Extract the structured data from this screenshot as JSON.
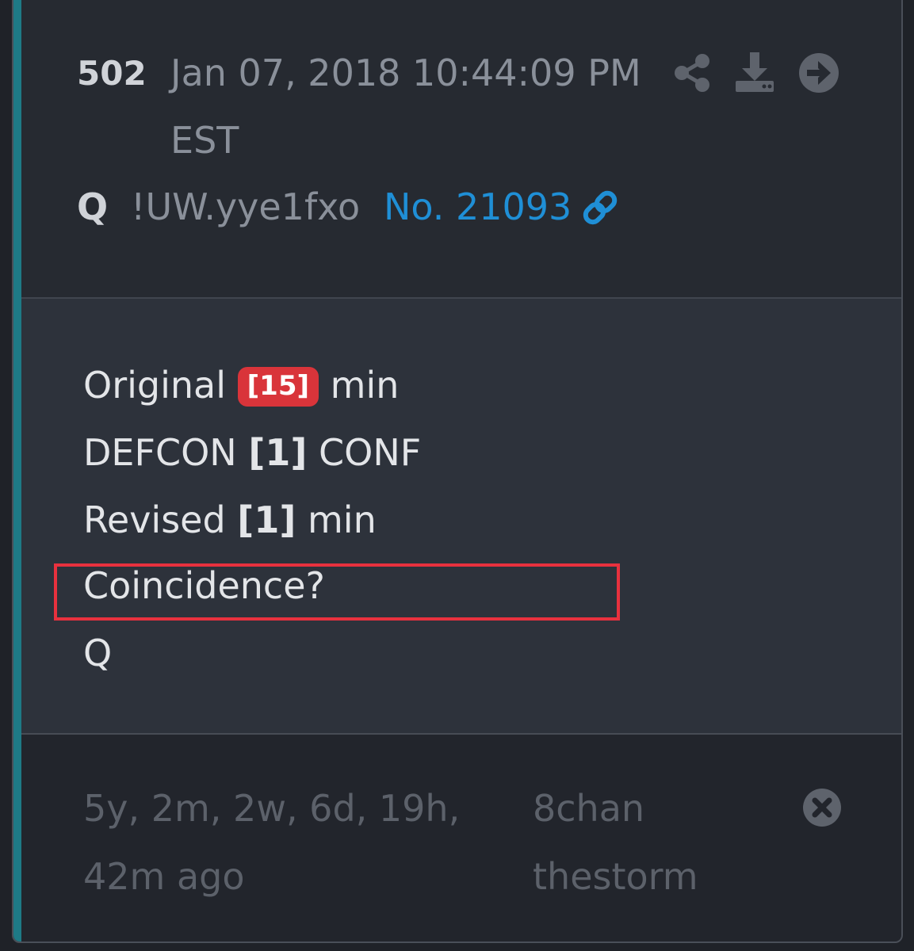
{
  "post": {
    "number": "502",
    "date": "Jan 07, 2018 10:44:09 PM",
    "timezone": "EST",
    "author": "Q",
    "tripcode": "!UW.yye1fxo",
    "post_no": "No. 21093"
  },
  "body": {
    "line1_pre": "Original ",
    "line1_badge": "[15]",
    "line1_post": " min",
    "line2_pre": "DEFCON ",
    "line2_bold": "[1]",
    "line2_post": " CONF",
    "line3_pre": "Revised ",
    "line3_bold": "[1]",
    "line3_post": " min",
    "line4": "Coincidence?",
    "line5": "Q"
  },
  "footer": {
    "ago": "5y, 2m, 2w, 6d, 19h, 42m ago",
    "board": "8chan thestorm"
  },
  "icons": {
    "share": "share-icon",
    "download": "download-icon",
    "goto": "arrow-right-circle-icon",
    "link": "link-icon",
    "close": "close-circle-icon"
  },
  "colors": {
    "accent": "#1e7a86",
    "link": "#1f8fd6",
    "badge": "#d9343a",
    "highlight": "#e8313e"
  }
}
